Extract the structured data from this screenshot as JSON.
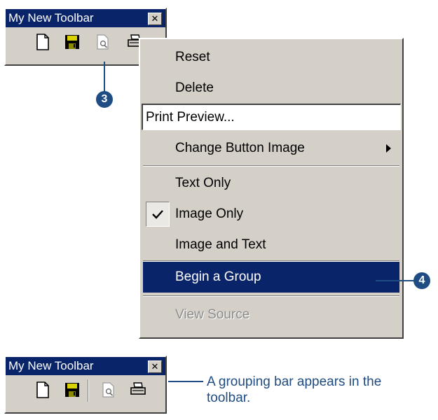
{
  "toolbar_top": {
    "title": "My New Toolbar",
    "close_glyph": "✕"
  },
  "toolbar_bottom": {
    "title": "My New Toolbar",
    "close_glyph": "✕"
  },
  "context_menu": {
    "reset": "Reset",
    "delete": "Delete",
    "name_value": "Print Preview...",
    "change_button_image": "Change Button Image",
    "text_only": "Text Only",
    "image_only": "Image Only",
    "image_and_text": "Image and Text",
    "begin_group": "Begin a Group",
    "view_source": "View Source",
    "image_only_checked": true
  },
  "callouts": {
    "step3": "3",
    "step4": "4"
  },
  "caption": {
    "text": "A grouping bar appears in the toolbar."
  },
  "colors": {
    "title_bar": "#0a246a",
    "highlight": "#0a246a",
    "callout": "#1e4c83",
    "face": "#d4d0c8"
  }
}
